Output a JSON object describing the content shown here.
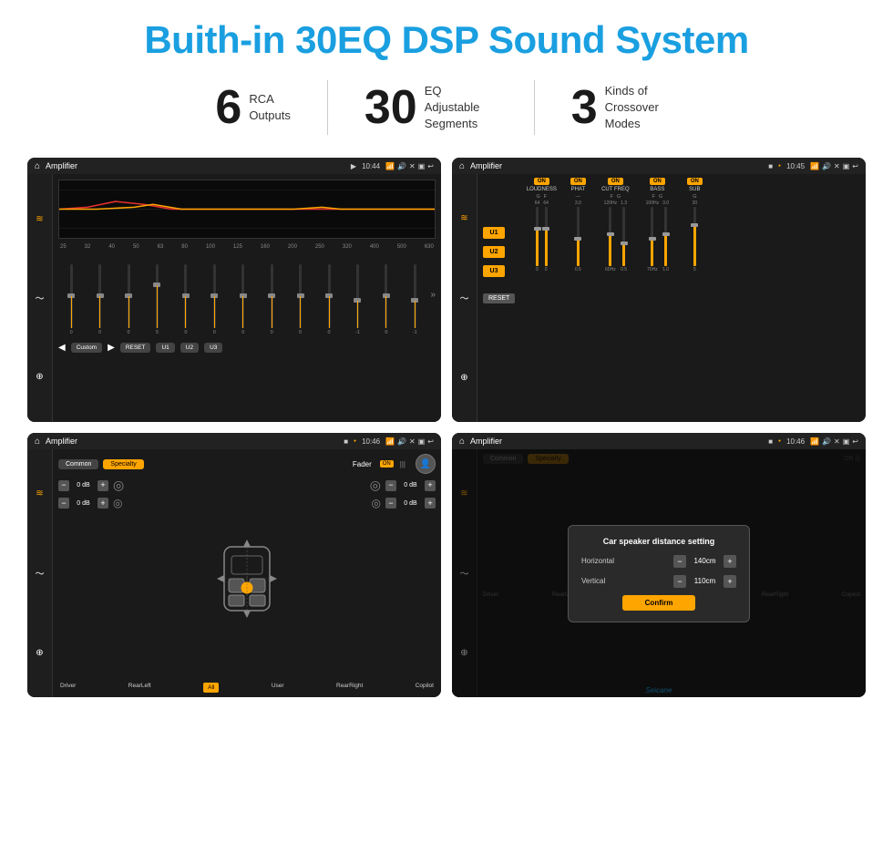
{
  "header": {
    "title": "Buith-in 30EQ DSP Sound System"
  },
  "stats": [
    {
      "number": "6",
      "label": "RCA\nOutputs"
    },
    {
      "number": "30",
      "label": "EQ Adjustable\nSegments"
    },
    {
      "number": "3",
      "label": "Kinds of\nCrossover Modes"
    }
  ],
  "screens": {
    "top_left": {
      "title": "Amplifier",
      "time": "10:44",
      "freq_labels": [
        "25",
        "32",
        "40",
        "50",
        "63",
        "80",
        "100",
        "125",
        "160",
        "200",
        "250",
        "320",
        "400",
        "500",
        "630"
      ],
      "slider_values": [
        "0",
        "0",
        "0",
        "5",
        "0",
        "0",
        "0",
        "0",
        "0",
        "0",
        "-1",
        "0",
        "-1"
      ],
      "buttons": [
        "Custom",
        "RESET",
        "U1",
        "U2",
        "U3"
      ]
    },
    "top_right": {
      "title": "Amplifier",
      "time": "10:45",
      "u_buttons": [
        "U1",
        "U2",
        "U3"
      ],
      "modules": [
        {
          "label": "LOUDNESS",
          "on": true
        },
        {
          "label": "PHAT",
          "on": true
        },
        {
          "label": "CUT FREQ",
          "on": true
        },
        {
          "label": "BASS",
          "on": true
        },
        {
          "label": "SUB",
          "on": true
        }
      ],
      "reset_label": "RESET"
    },
    "bottom_left": {
      "title": "Amplifier",
      "time": "10:46",
      "tabs": [
        "Common",
        "Specialty"
      ],
      "fader_label": "Fader",
      "on_label": "ON",
      "db_values": [
        "0 dB",
        "0 dB",
        "0 dB",
        "0 dB"
      ],
      "bottom_labels": [
        "Driver",
        "RearLeft",
        "All",
        "User",
        "RearRight",
        "Copilot"
      ]
    },
    "bottom_right": {
      "title": "Amplifier",
      "time": "10:46",
      "tabs": [
        "Common",
        "Specialty"
      ],
      "dialog": {
        "title": "Car speaker distance setting",
        "horizontal_label": "Horizontal",
        "horizontal_value": "140cm",
        "vertical_label": "Vertical",
        "vertical_value": "110cm",
        "confirm_label": "Confirm"
      },
      "bottom_labels": [
        "Driver",
        "RearLeft",
        "User",
        "RearRight",
        "Copilot"
      ]
    }
  },
  "watermark": "Seicane"
}
